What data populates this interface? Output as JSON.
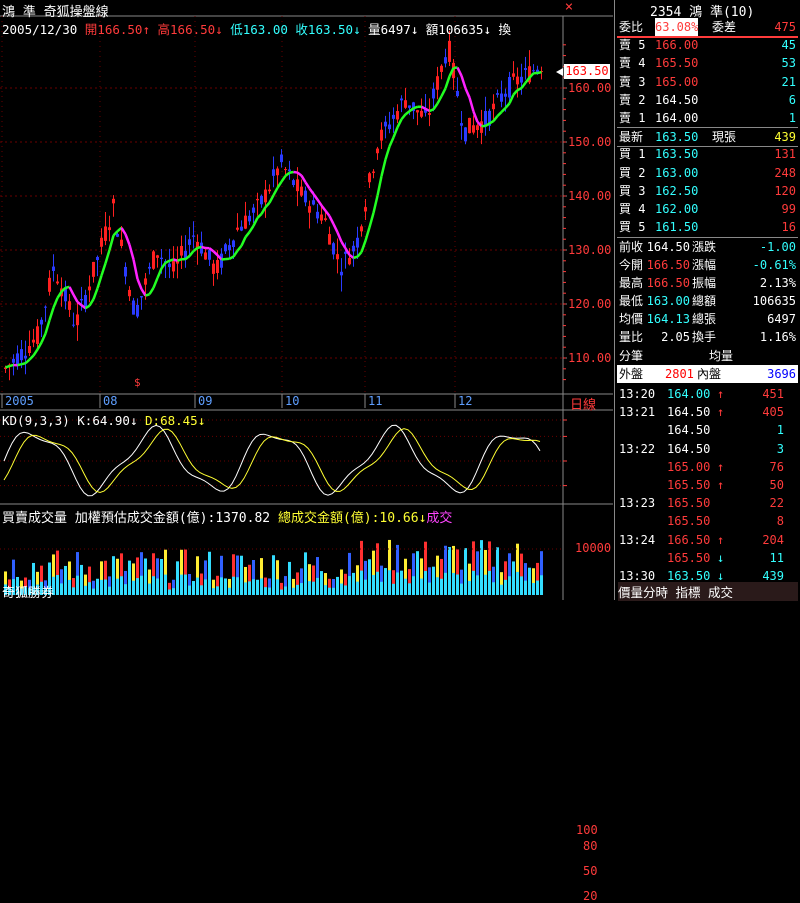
{
  "window": {
    "title_left": "鴻 準 奇狐操盤線",
    "close_label": "×",
    "title_right": "2354 鴻 準(10)"
  },
  "colors": {
    "up": "#ff2020",
    "down": "#2a3bff",
    "ma_up": "#22ff22",
    "ma_down": "#ff22ff",
    "grid": "#6a0000",
    "axis": "#888888"
  },
  "main_chart": {
    "info": [
      {
        "text": "2005/12/30",
        "color": "#ffffff"
      },
      {
        "text": "開166.50↑",
        "color": "#ff3b3b"
      },
      {
        "text": "高166.50↓",
        "color": "#ff3b3b"
      },
      {
        "text": "低163.00",
        "color": "#33ffff"
      },
      {
        "text": "收163.50↓",
        "color": "#33ffff"
      },
      {
        "text": "量6497↓",
        "color": "#ffffff"
      },
      {
        "text": "額106635↓",
        "color": "#ffffff"
      },
      {
        "text": "換",
        "color": "#ffffff"
      }
    ],
    "price_ticks": [
      "160.00",
      "150.00",
      "140.00",
      "130.00",
      "120.00",
      "110.00"
    ],
    "last_price_tag": "163.50",
    "x_labels": [
      "2005",
      "08",
      "09",
      "10",
      "11",
      "12"
    ],
    "axis_label": "日線",
    "marker_label": "$"
  },
  "kd_panel": {
    "title": "KD(9,3,3)",
    "k_text": "K:64.90↓",
    "d_text": "D:68.45↓",
    "ticks": [
      "100",
      "80",
      "50",
      "20"
    ]
  },
  "volume_panel": {
    "title": "買賣成交量",
    "index_text": "加權預估成交金額(億):1370.82",
    "total_text": "總成交金額(億):10.66↓",
    "trail_text": "成交",
    "tick": "10000",
    "bottom_label": "奇狐勝券"
  },
  "quote_panel": {
    "ratio_row": {
      "label": "委比",
      "value": "63.08%",
      "label2": "委差",
      "value2": "475"
    },
    "asks": [
      {
        "label": "賣 5",
        "price": "166.00",
        "qty": "45"
      },
      {
        "label": "賣 4",
        "price": "165.50",
        "qty": "53"
      },
      {
        "label": "賣 3",
        "price": "165.00",
        "qty": "21"
      },
      {
        "label": "賣 2",
        "price": "164.50",
        "qty": "6"
      },
      {
        "label": "賣 1",
        "price": "164.00",
        "qty": "1"
      }
    ],
    "last_row": {
      "label": "最新",
      "price": "163.50",
      "label2": "現張",
      "qty": "439"
    },
    "bids": [
      {
        "label": "買 1",
        "price": "163.50",
        "qty": "131"
      },
      {
        "label": "買 2",
        "price": "163.00",
        "qty": "248"
      },
      {
        "label": "買 3",
        "price": "162.50",
        "qty": "120"
      },
      {
        "label": "買 4",
        "price": "162.00",
        "qty": "99"
      },
      {
        "label": "買 5",
        "price": "161.50",
        "qty": "16"
      }
    ],
    "stats": [
      {
        "l1": "前收",
        "v1": "164.50",
        "l2": "漲跌",
        "v2": "-1.00"
      },
      {
        "l1": "今開",
        "v1": "166.50",
        "l2": "漲幅",
        "v2": "-0.61%"
      },
      {
        "l1": "最高",
        "v1": "166.50",
        "l2": "振幅",
        "v2": "2.13%"
      },
      {
        "l1": "最低",
        "v1": "163.00",
        "l2": "總額",
        "v2": "106635"
      },
      {
        "l1": "均價",
        "v1": "164.13",
        "l2": "總張",
        "v2": "6497"
      },
      {
        "l1": "量比",
        "v1": "2.05",
        "l2": "換手",
        "v2": "1.16%"
      }
    ],
    "avg_row": {
      "l1": "分筆",
      "l2": "均量"
    },
    "inout_row": {
      "l1": "外盤",
      "v1": "2801",
      "l2": "內盤",
      "v2": "3696"
    },
    "ticks": [
      {
        "time": "13:20",
        "price": "164.00",
        "arrow": "↑",
        "qty": "451",
        "pc": "#33ffff",
        "qc": "#ff3b3b"
      },
      {
        "time": "13:21",
        "price": "164.50",
        "arrow": "↑",
        "qty": "405",
        "pc": "#ffffff",
        "qc": "#ff3b3b"
      },
      {
        "time": "",
        "price": "164.50",
        "arrow": "",
        "qty": "1",
        "pc": "#ffffff",
        "qc": "#33ffff"
      },
      {
        "time": "13:22",
        "price": "164.50",
        "arrow": "",
        "qty": "3",
        "pc": "#ffffff",
        "qc": "#33ffff"
      },
      {
        "time": "",
        "price": "165.00",
        "arrow": "↑",
        "qty": "76",
        "pc": "#ff3b3b",
        "qc": "#ff3b3b"
      },
      {
        "time": "",
        "price": "165.50",
        "arrow": "↑",
        "qty": "50",
        "pc": "#ff3b3b",
        "qc": "#ff3b3b"
      },
      {
        "time": "13:23",
        "price": "165.50",
        "arrow": "",
        "qty": "22",
        "pc": "#ff3b3b",
        "qc": "#ff3b3b"
      },
      {
        "time": "",
        "price": "165.50",
        "arrow": "",
        "qty": "8",
        "pc": "#ff3b3b",
        "qc": "#ff3b3b"
      },
      {
        "time": "13:24",
        "price": "166.50",
        "arrow": "↑",
        "qty": "204",
        "pc": "#ff3b3b",
        "qc": "#ff3b3b"
      },
      {
        "time": "",
        "price": "165.50",
        "arrow": "↓",
        "qty": "11",
        "pc": "#ff3b3b",
        "qc": "#33ffff"
      },
      {
        "time": "13:30",
        "price": "163.50",
        "arrow": "↓",
        "qty": "439",
        "pc": "#33ffff",
        "qc": "#33ffff"
      }
    ],
    "footer": "價量分時 指標 成交"
  }
}
